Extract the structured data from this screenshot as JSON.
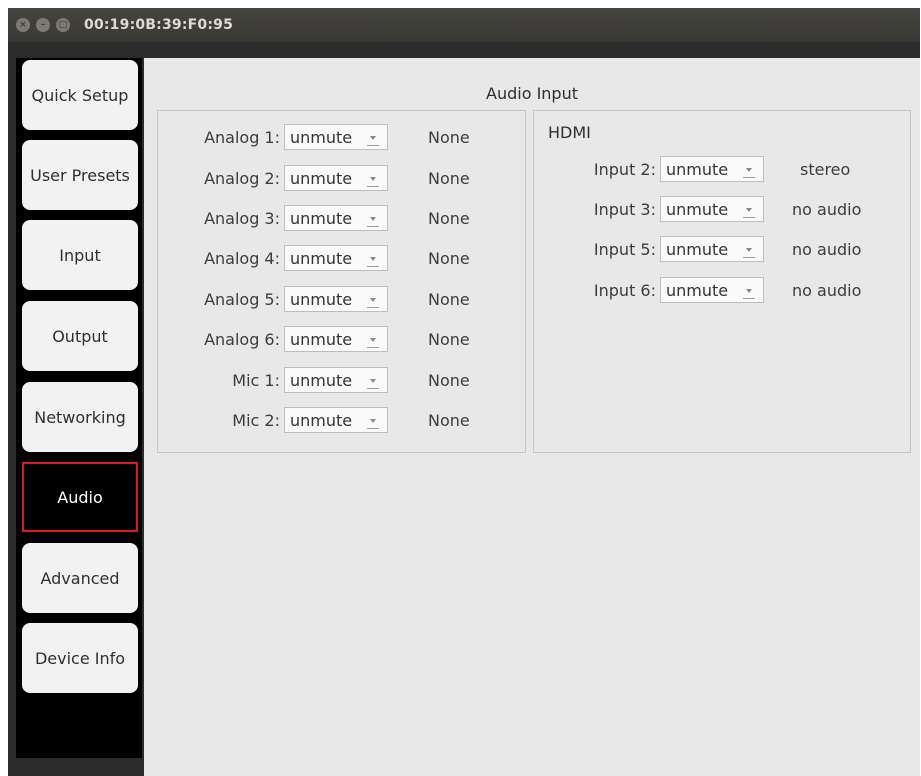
{
  "window": {
    "title": "00:19:0B:39:F0:95"
  },
  "sidebar": {
    "items": [
      {
        "label": "Quick Setup",
        "active": false
      },
      {
        "label": "User Presets",
        "active": false
      },
      {
        "label": "Input",
        "active": false
      },
      {
        "label": "Output",
        "active": false
      },
      {
        "label": "Networking",
        "active": false
      },
      {
        "label": "Audio",
        "active": true
      },
      {
        "label": "Advanced",
        "active": false
      },
      {
        "label": "Device Info",
        "active": false
      }
    ]
  },
  "content": {
    "title": "Audio Input",
    "analog": [
      {
        "label": "Analog 1:",
        "value": "unmute",
        "status": "None"
      },
      {
        "label": "Analog 2:",
        "value": "unmute",
        "status": "None"
      },
      {
        "label": "Analog 3:",
        "value": "unmute",
        "status": "None"
      },
      {
        "label": "Analog 4:",
        "value": "unmute",
        "status": "None"
      },
      {
        "label": "Analog 5:",
        "value": "unmute",
        "status": "None"
      },
      {
        "label": "Analog 6:",
        "value": "unmute",
        "status": "None"
      },
      {
        "label": "Mic 1:",
        "value": "unmute",
        "status": "None"
      },
      {
        "label": "Mic 2:",
        "value": "unmute",
        "status": "None"
      }
    ],
    "hdmi": {
      "title": "HDMI",
      "inputs": [
        {
          "label": "Input 2:",
          "value": "unmute",
          "status": "stereo"
        },
        {
          "label": "Input 3:",
          "value": "unmute",
          "status": "no audio"
        },
        {
          "label": "Input 5:",
          "value": "unmute",
          "status": "no audio"
        },
        {
          "label": "Input 6:",
          "value": "unmute",
          "status": "no audio"
        }
      ]
    }
  }
}
